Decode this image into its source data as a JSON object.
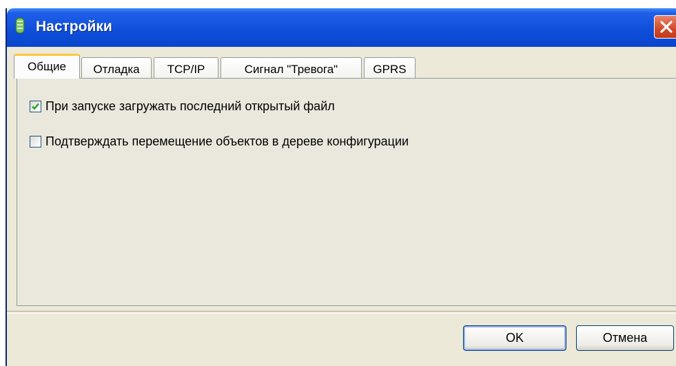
{
  "window": {
    "title": "Настройки"
  },
  "tabs": [
    {
      "label": "Общие",
      "active": true
    },
    {
      "label": "Отладка",
      "active": false
    },
    {
      "label": "TCP/IP",
      "active": false
    },
    {
      "label": "Сигнал \"Тревога\"",
      "active": false
    },
    {
      "label": "GPRS",
      "active": false
    }
  ],
  "general": {
    "options": [
      {
        "label": "При запуске загружать последний открытый файл",
        "checked": true
      },
      {
        "label": "Подтверждать перемещение объектов в дереве конфигурации",
        "checked": false
      }
    ]
  },
  "buttons": {
    "ok": "OK",
    "cancel": "Отмена"
  },
  "colors": {
    "title_bar": "#0A46CE",
    "accent_tab": "#FFC83C",
    "close": "#D1492A",
    "check": "#21A121"
  }
}
